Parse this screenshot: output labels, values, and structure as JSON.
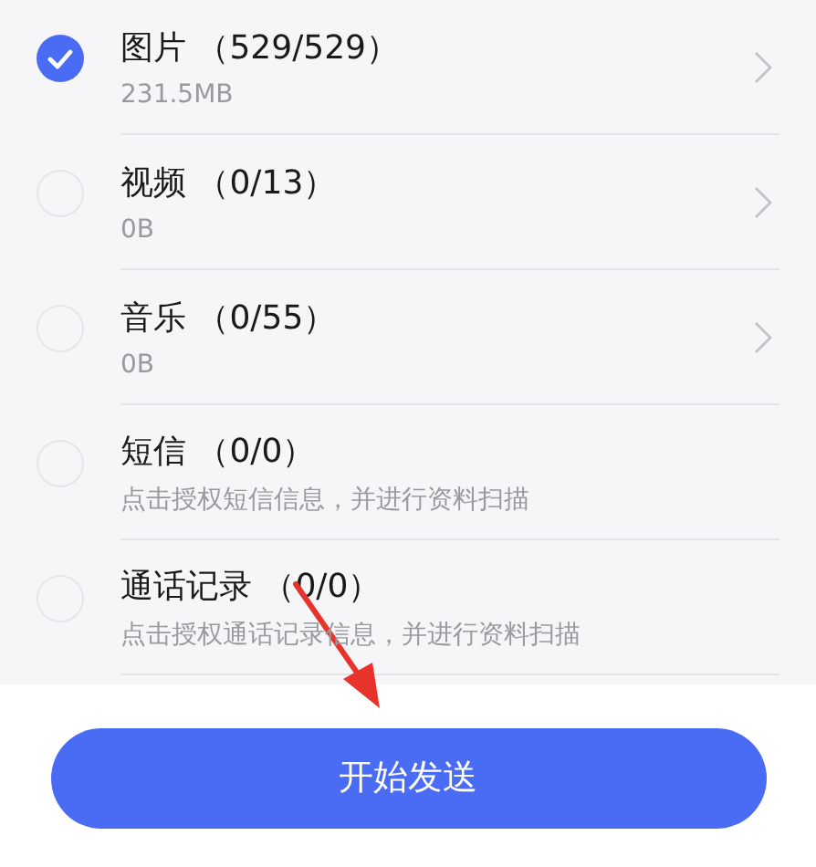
{
  "items": [
    {
      "title": "图片 （529/529）",
      "subtitle": "231.5MB",
      "checked": true,
      "has_detail": true
    },
    {
      "title": "视频 （0/13）",
      "subtitle": "0B",
      "checked": false,
      "has_detail": true
    },
    {
      "title": "音乐 （0/55）",
      "subtitle": "0B",
      "checked": false,
      "has_detail": true
    },
    {
      "title": "短信 （0/0）",
      "subtitle": "点击授权短信信息，并进行资料扫描",
      "checked": false,
      "has_detail": false
    },
    {
      "title": "通话记录 （0/0）",
      "subtitle": "点击授权通话记录信息，并进行资料扫描",
      "checked": false,
      "has_detail": false
    }
  ],
  "send_button": "开始发送",
  "annotation": {
    "kind": "arrow",
    "color": "#e8322c"
  }
}
